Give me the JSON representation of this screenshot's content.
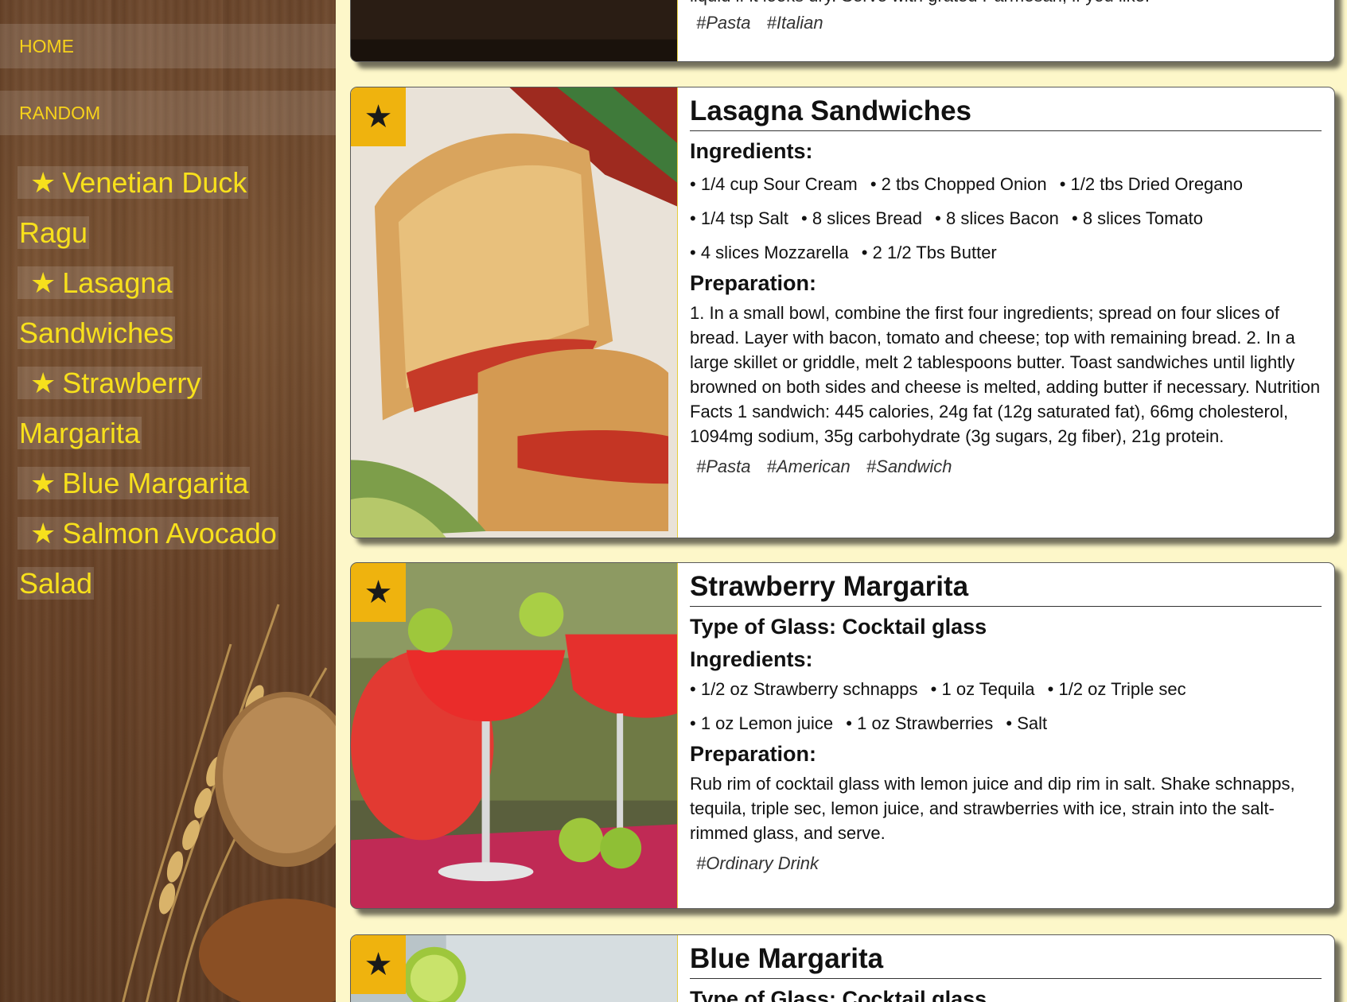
{
  "nav": {
    "home": "HOME",
    "random": "RANDOM"
  },
  "favorites": [
    {
      "label": "Venetian Duck Ragu",
      "star": "★"
    },
    {
      "label": "Lasagna Sandwiches",
      "star": "★"
    },
    {
      "label": "Strawberry Margarita",
      "star": "★"
    },
    {
      "label": "Blue Margarita",
      "star": "★"
    },
    {
      "label": "Salmon Avocado Salad",
      "star": "★"
    }
  ],
  "cards": {
    "prev": {
      "prep_tail": "liquid if it looks dry. Serve with grated Parmesan, if you like.",
      "tags": [
        "#Pasta",
        "#Italian"
      ]
    },
    "lasagna": {
      "star": "★",
      "title": "Lasagna Sandwiches",
      "ingredients_label": "Ingredients:",
      "ingredients": [
        "1/4 cup Sour Cream",
        "2 tbs Chopped Onion",
        "1/2 tbs Dried Oregano",
        "1/4 tsp Salt",
        "8 slices Bread",
        "8 slices Bacon",
        "8 slices Tomato",
        "4 slices Mozzarella",
        "2 1/2 Tbs Butter"
      ],
      "preparation_label": "Preparation:",
      "preparation": "1. In a small bowl, combine the first four ingredients; spread on four slices of bread. Layer with bacon, tomato and cheese; top with remaining bread. 2. In a large skillet or griddle, melt 2 tablespoons butter. Toast sandwiches until lightly browned on both sides and cheese is melted, adding butter if necessary. Nutrition Facts 1 sandwich: 445 calories, 24g fat (12g saturated fat), 66mg cholesterol, 1094mg sodium, 35g carbohydrate (3g sugars, 2g fiber), 21g protein.",
      "tags": [
        "#Pasta",
        "#American",
        "#Sandwich"
      ]
    },
    "strawberry": {
      "star": "★",
      "title": "Strawberry Margarita",
      "glass": "Type of Glass: Cocktail glass",
      "ingredients_label": "Ingredients:",
      "ingredients": [
        "1/2 oz Strawberry schnapps",
        "1 oz Tequila",
        "1/2 oz Triple sec",
        "1 oz Lemon juice",
        "1 oz Strawberries",
        "Salt"
      ],
      "preparation_label": "Preparation:",
      "preparation": "Rub rim of cocktail glass with lemon juice and dip rim in salt. Shake schnapps, tequila, triple sec, lemon juice, and strawberries with ice, strain into the salt-rimmed glass, and serve.",
      "tags": [
        "#Ordinary Drink"
      ]
    },
    "blue": {
      "star": "★",
      "title": "Blue Margarita",
      "glass": "Type of Glass: Cocktail glass"
    }
  },
  "colors": {
    "page_bg": "#fdf7c9",
    "nav_text": "#f7d21b",
    "star_badge": "#efb30e"
  }
}
